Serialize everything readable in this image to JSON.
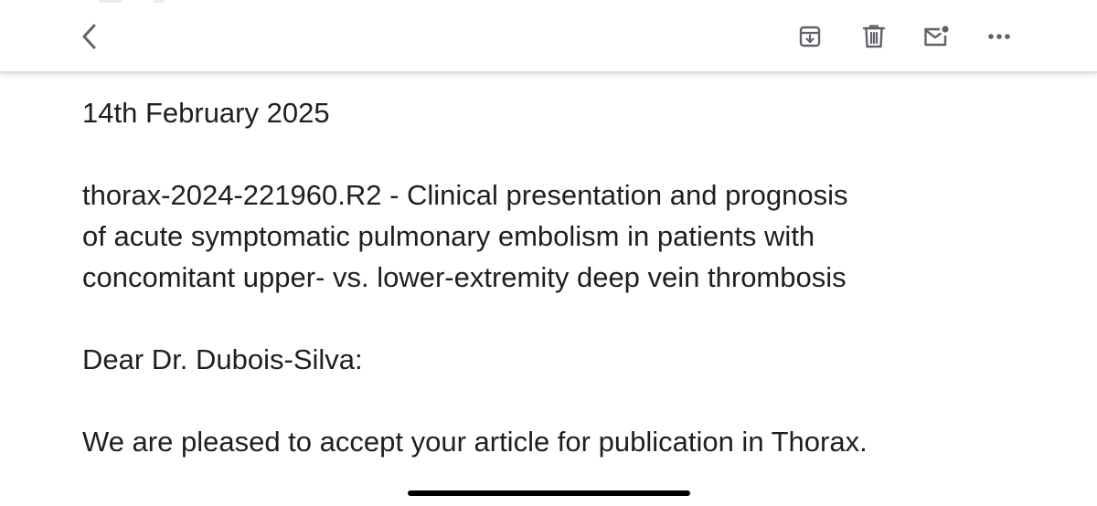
{
  "toolbar": {
    "back_icon": "chevron-left-icon",
    "archive_icon": "archive-icon",
    "delete_icon": "trash-icon",
    "mark_unread_icon": "mail-unread-icon",
    "more_icon": "more-horizontal-icon",
    "icon_color": "#5f6368"
  },
  "email": {
    "date": "14th February 2025",
    "subject_line_1": "thorax-2024-221960.R2 - Clinical presentation and prognosis",
    "subject_line_2": "of acute symptomatic pulmonary embolism in patients with",
    "subject_line_3": "concomitant upper- vs. lower-extremity deep vein thrombosis",
    "greeting": "Dear Dr. Dubois-Silva:",
    "body": "We are pleased to accept your article for publication in Thorax."
  },
  "colors": {
    "text": "#1f1f1f",
    "background": "#ffffff",
    "home_indicator": "#000000"
  }
}
